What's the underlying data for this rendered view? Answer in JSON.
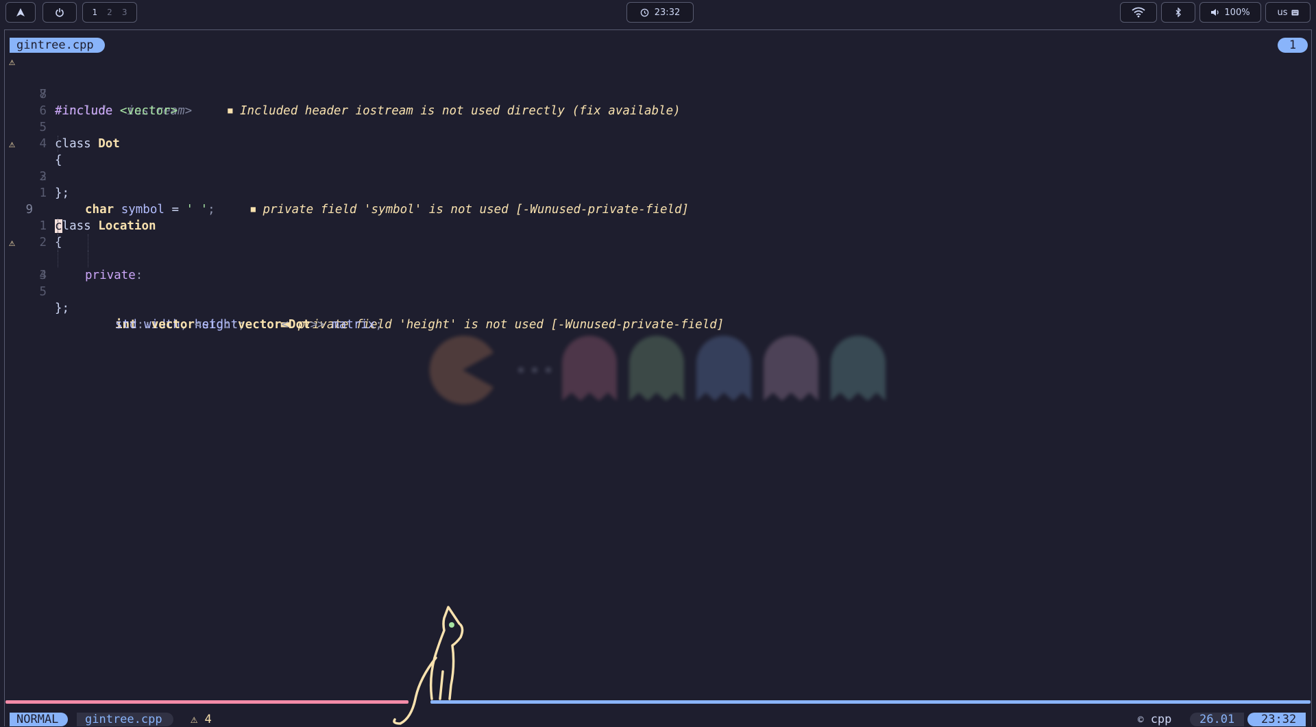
{
  "topbar": {
    "workspaces": [
      "1",
      "2",
      "3"
    ],
    "clock": "23:32",
    "volume": "100%",
    "keyboard_layout": "us",
    "icons": [
      "arch-logo-icon",
      "power-icon",
      "clock-icon",
      "wifi-icon",
      "bluetooth-icon",
      "volume-icon",
      "keyboard-icon"
    ]
  },
  "editor": {
    "tab_filename": "gintree.cpp",
    "buffer_number": "1",
    "lines": {
      "l1": {
        "num": "8",
        "a": "#include ",
        "b": "<iostream>",
        "diag_marker": "■",
        "diag": "Included header iostream is not used directly (fix available)"
      },
      "l2": {
        "num": "7",
        "a": "#include ",
        "b": "<vector>"
      },
      "l3": {
        "num": "6"
      },
      "l4": {
        "num": "5",
        "a": "class ",
        "b": "Dot"
      },
      "l5": {
        "num": "4",
        "a": "{"
      },
      "l6": {
        "num": "3",
        "a": "char",
        "b": " symbol",
        "c": " = ",
        "d": "' '",
        "e": ";",
        "diag_marker": "■",
        "diag": "private field 'symbol' is not used [-Wunused-private-field]"
      },
      "l7": {
        "num": "2",
        "a": "};"
      },
      "l8": {
        "num": "1"
      },
      "l9": {
        "num": "9",
        "cursor": "c",
        "a": "lass ",
        "b": "Location"
      },
      "l10": {
        "num": "1",
        "a": "{"
      },
      "l11": {
        "num": "2",
        "a": "private",
        "b": ":"
      },
      "l12": {
        "num": "3",
        "a": "int",
        "b": " width",
        "c": ",",
        "d": " height",
        "e": ";",
        "diag_marker": "■■",
        "diag": "private field 'height' is not used [-Wunused-private-field]"
      },
      "l13": {
        "num": "4",
        "a": "std",
        "b": "::",
        "c": "vector",
        "d": "<",
        "e": "std",
        "f": "::",
        "g": "vector",
        "h": "<",
        "i": "Dot",
        "j": ">>",
        "k": " matrix",
        "l": ";"
      },
      "l14": {
        "num": "5",
        "a": "};"
      }
    }
  },
  "statusline": {
    "mode": "NORMAL",
    "filename": "gintree.cpp",
    "warnings_icon": "⚠",
    "warnings": "4",
    "filetype_icon": "cpp-icon",
    "filetype": "cpp",
    "position": "26.01",
    "time": "23:32"
  },
  "colors": {
    "background": "#1e1e2e",
    "accent": "#89b4fa",
    "warning": "#f9e2af",
    "error_bar": "#f38ba8",
    "keyword": "#cba6f7",
    "string": "#a6e3a1"
  }
}
